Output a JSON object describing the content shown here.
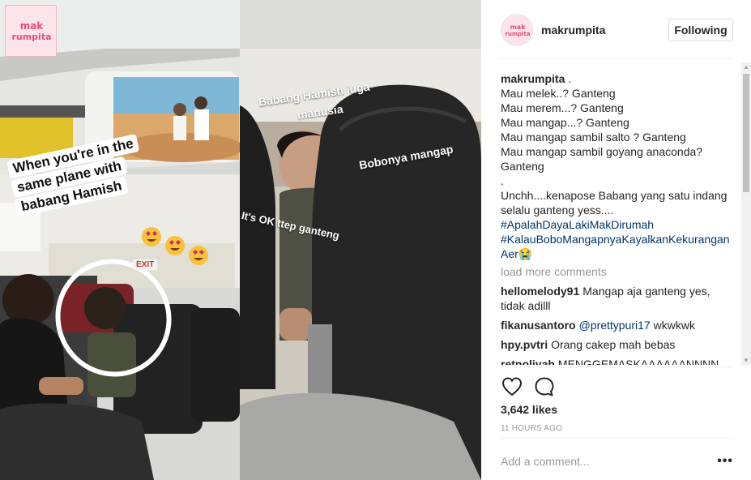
{
  "photo": {
    "logo_line1": "mak",
    "logo_line2": "rumpita",
    "left_caption_lines": [
      "When you're in the",
      "same plane with",
      "babang Hamish"
    ],
    "right_text_top": "Babang Hamish juga",
    "right_text_top2": "manusia",
    "right_text_middle": "Bobonya mangap",
    "right_text_left": "It's OK ttep ganteng",
    "exit_sign": "EXIT"
  },
  "header": {
    "username": "makrumpita",
    "follow_label": "Following",
    "avatar_line1": "mak",
    "avatar_line2": "rumpita"
  },
  "caption": {
    "user": "makrumpita",
    "lines": [
      "Mau melek..? Ganteng",
      "Mau merem...? Ganteng",
      "Mau mangap...? Ganteng",
      "Mau mangap sambil salto ? Ganteng",
      "Mau mangap sambil goyang anaconda? Ganteng",
      ".",
      "Unchh....kenapose Babang yang satu indang selalu ganteng yess...."
    ],
    "hashtag1": "#ApalahDayaLakiMakDirumah",
    "hashtag2": "#KalauBoboMangapnyaKayalkanKekuranganAer",
    "hashtag2_emoji": "😭"
  },
  "load_more": "load more comments",
  "comments": [
    {
      "user": "hellomelody91",
      "text": "Mangap aja ganteng yes, tidak adilll"
    },
    {
      "user": "fikanusantoro",
      "mention": "@prettypuri17",
      "text": "wkwkwk"
    },
    {
      "user": "hpy.pvtri",
      "text": "Orang cakep mah bebas"
    },
    {
      "user": "retnoliyah",
      "text": "MENGGEMASKAAAAAANNNN"
    }
  ],
  "actions": {
    "like_icon": "heart-icon",
    "comment_icon": "comment-icon",
    "likes": "3,642 likes",
    "time": "11 HOURS AGO"
  },
  "add_comment": {
    "placeholder": "Add a comment...",
    "more": "•••"
  },
  "colors": {
    "link": "#003569",
    "muted": "#999999",
    "text": "#262626",
    "border": "#efefef"
  }
}
